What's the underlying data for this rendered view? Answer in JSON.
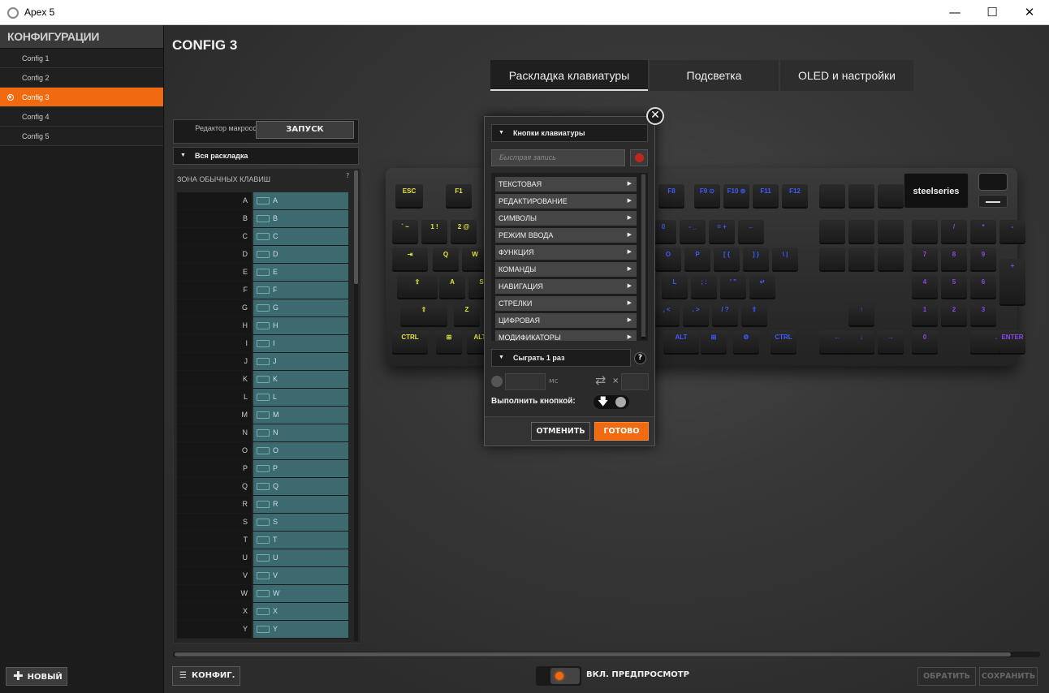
{
  "window": {
    "title": "Apex 5",
    "min": "—",
    "max": "☐",
    "close": "✕"
  },
  "sidebar": {
    "header": "КОНФИГУРАЦИИ",
    "items": [
      {
        "label": "Config 1"
      },
      {
        "label": "Config 2"
      },
      {
        "label": "Config 3",
        "active": true
      },
      {
        "label": "Config 4"
      },
      {
        "label": "Config 5"
      }
    ],
    "new_button": "НОВЫЙ"
  },
  "main": {
    "config_title": "CONFIG 3",
    "tabs": [
      {
        "label": "Раскладка клавиатуры",
        "active": true
      },
      {
        "label": "Подсветка"
      },
      {
        "label": "OLED и настройки"
      }
    ],
    "macro_editor_label": "Редактор макросов",
    "run_button": "ЗАПУСК",
    "layout_select": "Вся раскладка",
    "zone_title": "ЗОНА ОБЫЧНЫХ КЛАВИШ",
    "zone_help": "?",
    "keys": [
      {
        "key": "A",
        "map": "A"
      },
      {
        "key": "B",
        "map": "B"
      },
      {
        "key": "C",
        "map": "C"
      },
      {
        "key": "D",
        "map": "D"
      },
      {
        "key": "E",
        "map": "E"
      },
      {
        "key": "F",
        "map": "F"
      },
      {
        "key": "G",
        "map": "G"
      },
      {
        "key": "H",
        "map": "H"
      },
      {
        "key": "I",
        "map": "I"
      },
      {
        "key": "J",
        "map": "J"
      },
      {
        "key": "K",
        "map": "K"
      },
      {
        "key": "L",
        "map": "L"
      },
      {
        "key": "M",
        "map": "M"
      },
      {
        "key": "N",
        "map": "N"
      },
      {
        "key": "O",
        "map": "O"
      },
      {
        "key": "P",
        "map": "P"
      },
      {
        "key": "Q",
        "map": "Q"
      },
      {
        "key": "R",
        "map": "R"
      },
      {
        "key": "S",
        "map": "S"
      },
      {
        "key": "T",
        "map": "T"
      },
      {
        "key": "U",
        "map": "U"
      },
      {
        "key": "V",
        "map": "V"
      },
      {
        "key": "W",
        "map": "W"
      },
      {
        "key": "X",
        "map": "X"
      },
      {
        "key": "Y",
        "map": "Y"
      }
    ],
    "config_button": "КОНФИГ.",
    "preview_label": "ВКЛ. ПРЕДПРОСМОТР",
    "revert_button": "ОБРАТИТЬ",
    "save_button": "СОХРАНИТЬ"
  },
  "keyboard": {
    "brand": "steelseries",
    "keys": [
      {
        "label": "ESC",
        "c": "ky"
      },
      {
        "label": "F1",
        "c": "ky"
      },
      {
        "label": "F8",
        "c": "kb"
      },
      {
        "label": "F9 ⊙",
        "c": "kb"
      },
      {
        "label": "F10 ⊚",
        "c": "kb"
      },
      {
        "label": "F11",
        "c": "kb"
      },
      {
        "label": "F12",
        "c": "kb"
      },
      {
        "label": "",
        "c": "kb"
      },
      {
        "label": "",
        "c": "kb"
      },
      {
        "label": "",
        "c": "kp"
      },
      {
        "label": "` ~",
        "c": "ky"
      },
      {
        "label": "1 !",
        "c": "ky"
      },
      {
        "label": "2 @",
        "c": "ky"
      },
      {
        "label": "0",
        "c": "kb"
      },
      {
        "label": "- _",
        "c": "kb"
      },
      {
        "label": "= +",
        "c": "kb"
      },
      {
        "label": "←",
        "c": "kb"
      },
      {
        "label": "",
        "c": "kb"
      },
      {
        "label": "",
        "c": "kb"
      },
      {
        "label": "",
        "c": "kp"
      },
      {
        "label": "",
        "c": "kp"
      },
      {
        "label": "/",
        "c": "kp"
      },
      {
        "label": "*",
        "c": "kp"
      },
      {
        "label": "-",
        "c": "kp"
      },
      {
        "label": "⇥",
        "c": "ky"
      },
      {
        "label": "Q",
        "c": "ky"
      },
      {
        "label": "W",
        "c": "ky"
      },
      {
        "label": "O",
        "c": "kb"
      },
      {
        "label": "P",
        "c": "kb"
      },
      {
        "label": "[ {",
        "c": "kb"
      },
      {
        "label": "] }",
        "c": "kb"
      },
      {
        "label": "\\ |",
        "c": "kb"
      },
      {
        "label": "",
        "c": "kb"
      },
      {
        "label": "",
        "c": "kb"
      },
      {
        "label": "",
        "c": "kp"
      },
      {
        "label": "7",
        "c": "kp"
      },
      {
        "label": "8",
        "c": "kp"
      },
      {
        "label": "9",
        "c": "kp"
      },
      {
        "label": "+",
        "c": "kp"
      },
      {
        "label": "⇪",
        "c": "ky"
      },
      {
        "label": "A",
        "c": "ky"
      },
      {
        "label": "S",
        "c": "ky"
      },
      {
        "label": "L",
        "c": "kb"
      },
      {
        "label": "; :",
        "c": "kb"
      },
      {
        "label": "' \"",
        "c": "kb"
      },
      {
        "label": "↵",
        "c": "kb"
      },
      {
        "label": "4",
        "c": "kp"
      },
      {
        "label": "5",
        "c": "kp"
      },
      {
        "label": "6",
        "c": "kp"
      },
      {
        "label": "⇧",
        "c": "ky"
      },
      {
        "label": "Z",
        "c": "ky"
      },
      {
        "label": ", <",
        "c": "kb"
      },
      {
        "label": ". >",
        "c": "kb"
      },
      {
        "label": "/ ?",
        "c": "kb"
      },
      {
        "label": "⇧",
        "c": "kb"
      },
      {
        "label": "↑",
        "c": "kb"
      },
      {
        "label": "1",
        "c": "kp"
      },
      {
        "label": "2",
        "c": "kp"
      },
      {
        "label": "3",
        "c": "kp"
      },
      {
        "label": "CTRL",
        "c": "ky"
      },
      {
        "label": "⊞",
        "c": "ky"
      },
      {
        "label": "ALT",
        "c": "ky"
      },
      {
        "label": "ALT",
        "c": "kb"
      },
      {
        "label": "⊞",
        "c": "kb"
      },
      {
        "label": "⚙",
        "c": "kb"
      },
      {
        "label": "CTRL",
        "c": "kb"
      },
      {
        "label": "←",
        "c": "kb"
      },
      {
        "label": "↓",
        "c": "kb"
      },
      {
        "label": "→",
        "c": "kb"
      },
      {
        "label": "0",
        "c": "kp"
      },
      {
        "label": ".",
        "c": "kp"
      },
      {
        "label": "ENTER",
        "c": "kp"
      }
    ]
  },
  "modal": {
    "close": "✕",
    "type_select": "Кнопки клавиатуры",
    "quick_record_placeholder": "Быстрая запись",
    "categories": [
      {
        "label": "ТЕКСТОВАЯ"
      },
      {
        "label": "РЕДАКТИРОВАНИЕ"
      },
      {
        "label": "СИМВОЛЫ"
      },
      {
        "label": "РЕЖИМ ВВОДА"
      },
      {
        "label": "ФУНКЦИЯ"
      },
      {
        "label": "КОМАНДЫ"
      },
      {
        "label": "НАВИГАЦИЯ"
      },
      {
        "label": "СТРЕЛКИ"
      },
      {
        "label": "ЦИФРОВАЯ"
      },
      {
        "label": "МОДИФИКАТОРЫ"
      }
    ],
    "play_select": "Сыграть 1 раз",
    "help": "?",
    "delay_unit": "мс",
    "repeat_x": "×",
    "execute_label": "Выполнить кнопкой:",
    "cancel": "ОТМЕНИТЬ",
    "done": "ГОТОВО"
  }
}
